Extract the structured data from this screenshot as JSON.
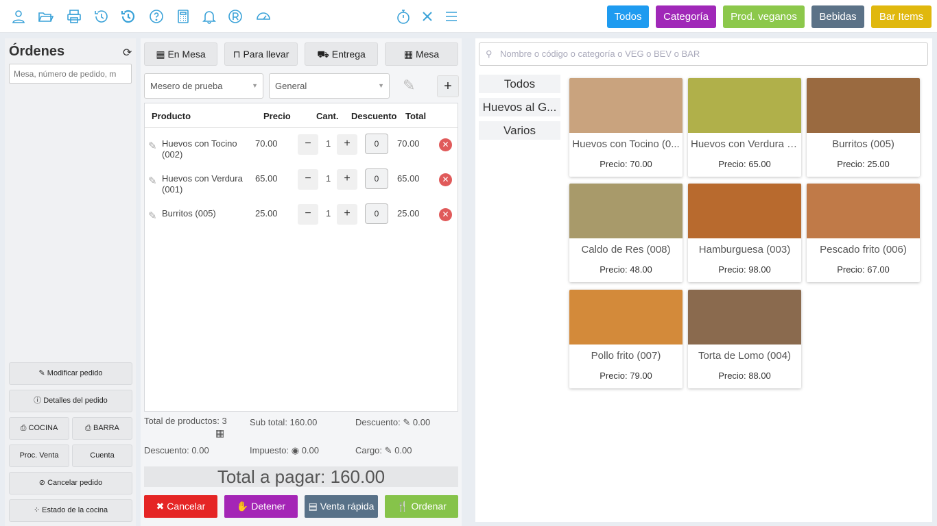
{
  "toolbar": {
    "icons": [
      "user-icon",
      "folder-open-icon",
      "printer-icon",
      "history-icon",
      "undo-history-icon",
      "help-icon",
      "calculator-icon",
      "bell-icon",
      "registered-icon",
      "dashboard-icon",
      "stopwatch-icon",
      "close-icon",
      "menu-icon"
    ],
    "categories": [
      {
        "label": "Todos",
        "color": "#1e9bf0"
      },
      {
        "label": "Categoría",
        "color": "#a028b8"
      },
      {
        "label": "Prod. veganos",
        "color": "#8cc84b"
      },
      {
        "label": "Bebidas",
        "color": "#5b7287"
      },
      {
        "label": "Bar Items",
        "color": "#e0b80e"
      }
    ]
  },
  "orders": {
    "title": "Órdenes",
    "search_placeholder": "Mesa, número de pedido, m",
    "buttons": {
      "modify": "Modificar pedido",
      "details": "Detalles del pedido",
      "kitchen": "COCINA",
      "bar": "BARRA",
      "proc_sale": "Proc. Venta",
      "account": "Cuenta",
      "cancel_order": "Cancelar pedido",
      "kitchen_status": "Estado de la cocina"
    }
  },
  "cart": {
    "order_types": [
      "En Mesa",
      "Para llevar",
      "Entrega",
      "Mesa"
    ],
    "waiter": "Mesero de prueba",
    "customer": "General",
    "columns": {
      "product": "Producto",
      "price": "Precio",
      "qty": "Cant.",
      "discount": "Descuento",
      "total": "Total"
    },
    "items": [
      {
        "name": "Huevos con Tocino (002)",
        "price": "70.00",
        "qty": "1",
        "discount": "0",
        "total": "70.00"
      },
      {
        "name": "Huevos con Verdura (001)",
        "price": "65.00",
        "qty": "1",
        "discount": "0",
        "total": "65.00"
      },
      {
        "name": "Burritos (005)",
        "price": "25.00",
        "qty": "1",
        "discount": "0",
        "total": "25.00"
      }
    ],
    "summary": {
      "total_products": "Total de productos: 3",
      "subtotal": "Sub total: 160.00",
      "discount_edit": "Descuento:",
      "discount_edit_value": "0.00",
      "discount": "Descuento: 0.00",
      "tax": "Impuesto:",
      "tax_value": "0.00",
      "charge": "Cargo:",
      "charge_value": "0.00"
    },
    "total_to_pay": "Total a pagar: 160.00",
    "actions": {
      "cancel": "Cancelar",
      "hold": "Detener",
      "quick_sale": "Venta rápida",
      "order": "Ordenar"
    },
    "action_colors": {
      "cancel": "#e52525",
      "hold": "#a425b6",
      "quick_sale": "#587188",
      "order": "#86c34a"
    }
  },
  "products": {
    "search_placeholder": "Nombre o código o categoría o VEG o BEV o BAR",
    "categories": [
      "Todos",
      "Huevos al G...",
      "Varios"
    ],
    "items": [
      {
        "name": "Huevos con Tocino (0...",
        "price": "Precio: 70.00",
        "color": "#c9a37e"
      },
      {
        "name": "Huevos con Verdura (...",
        "price": "Precio: 65.00",
        "color": "#b0b04a"
      },
      {
        "name": "Burritos (005)",
        "price": "Precio: 25.00",
        "color": "#9a6a40"
      },
      {
        "name": "Caldo de Res (008)",
        "price": "Precio: 48.00",
        "color": "#a89a6a"
      },
      {
        "name": "Hamburguesa (003)",
        "price": "Precio: 98.00",
        "color": "#b86a2e"
      },
      {
        "name": "Pescado frito (006)",
        "price": "Precio: 67.00",
        "color": "#c07a48"
      },
      {
        "name": "Pollo frito (007)",
        "price": "Precio: 79.00",
        "color": "#d38a3a"
      },
      {
        "name": "Torta de Lomo (004)",
        "price": "Precio: 88.00",
        "color": "#8a6a4e"
      }
    ]
  }
}
